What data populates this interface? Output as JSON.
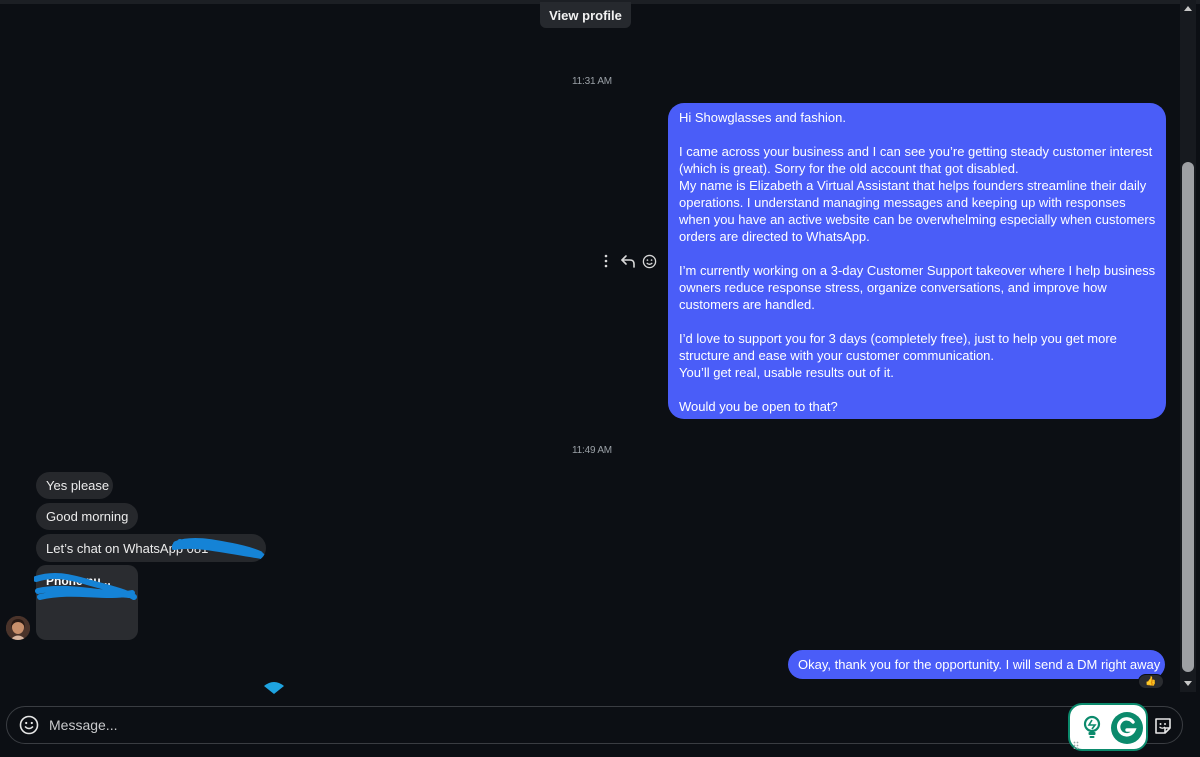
{
  "header": {
    "view_profile_label": "View profile"
  },
  "timestamps": [
    "11:31 AM",
    "11:49 AM"
  ],
  "outgoing_long_message": {
    "paragraphs": [
      "Hi Showglasses and fashion.",
      "I came across your business and I can see you’re getting steady customer interest (which is great). Sorry for the old account that got disabled.\nMy name is Elizabeth a Virtual Assistant that helps founders streamline their daily operations. I understand managing messages and keeping up with responses when you have an active website can be overwhelming especially when customers orders are directed to WhatsApp.",
      "I’m currently working on a 3-day Customer Support takeover where I help business owners reduce response stress, organize conversations, and improve how customers are handled.",
      "I’d love to support you for 3 days (completely free), just to help you get more structure and ease with your customer communication.\nYou’ll get real, usable results out of it.",
      "Would you be open to that?"
    ]
  },
  "incoming_messages": [
    {
      "text": "Yes please"
    },
    {
      "text": "Good morning"
    },
    {
      "text": "Let’s chat on WhatsApp 081"
    }
  ],
  "phone_card": {
    "title": "Phone nu..."
  },
  "outgoing_reply": {
    "text": "Okay, thank you for the opportunity. I will send a DM right away",
    "reaction": "👍"
  },
  "composer": {
    "placeholder": "Message..."
  },
  "colors": {
    "background": "#0c0f14",
    "outgoing_bubble": "#4a5df8",
    "incoming_bubble": "#26282c",
    "scribble": "#1583d6",
    "grammarly": "#0b8a6c"
  },
  "icons": {
    "more": "more-vertical-icon",
    "reply": "reply-icon",
    "react": "emoji-icon",
    "composer_emoji": "emoji-icon",
    "sticker": "sticker-icon",
    "grammarly": "grammarly-icon",
    "lightbulb": "lightbulb-icon"
  }
}
